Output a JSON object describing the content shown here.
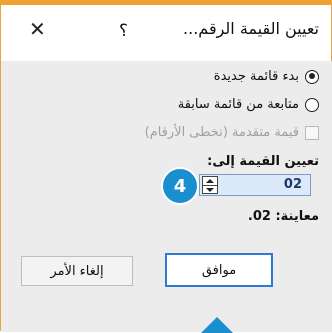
{
  "dialog": {
    "title": "تعيين القيمة الرقم...",
    "help_label": "؟",
    "close_label": "✕"
  },
  "options": {
    "new_list": "بدء قائمة جديدة",
    "continue_list": "متابعة من قائمة سابقة",
    "advance_value": "قيمة متقدمة (تخطى الأرقام)"
  },
  "value": {
    "label": "تعيين القيمة إلى:",
    "current": "02",
    "preview_label": "معاينة: 02."
  },
  "annotation": {
    "step": "4",
    "color": "#1a8fcf"
  },
  "buttons": {
    "ok": "موافق",
    "cancel": "إلغاء الأمر"
  },
  "colors": {
    "accent": "#f0a030",
    "primary_border": "#2d7ad6"
  }
}
